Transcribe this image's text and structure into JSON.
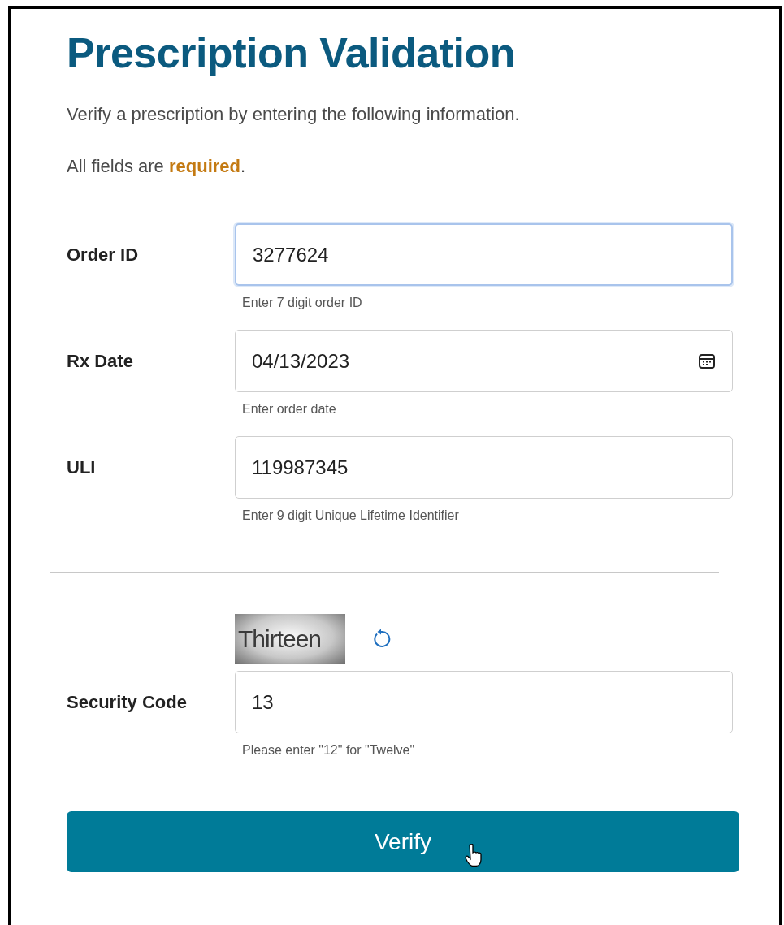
{
  "title": "Prescription Validation",
  "intro": "Verify a prescription by entering the following information.",
  "required_note": {
    "before": "All fields are ",
    "emphasis": "required",
    "after": "."
  },
  "fields": [
    {
      "kind": "text",
      "label": "Order ID",
      "value": "3277624",
      "hint": "Enter 7 digit order ID",
      "focused": true
    },
    {
      "kind": "date",
      "label": "Rx Date",
      "value": "04/13/2023",
      "hint": "Enter order date",
      "focused": false
    },
    {
      "kind": "text",
      "label": "ULI",
      "value": "119987345",
      "hint": "Enter 9 digit Unique Lifetime Identifier",
      "focused": false
    }
  ],
  "security": {
    "captcha": "Thirteen",
    "label": "Security Code",
    "value": "13",
    "hint": "Please enter \"12\" for \"Twelve\"",
    "focused": false
  },
  "submit": {
    "label": "Verify",
    "hovered": true
  }
}
